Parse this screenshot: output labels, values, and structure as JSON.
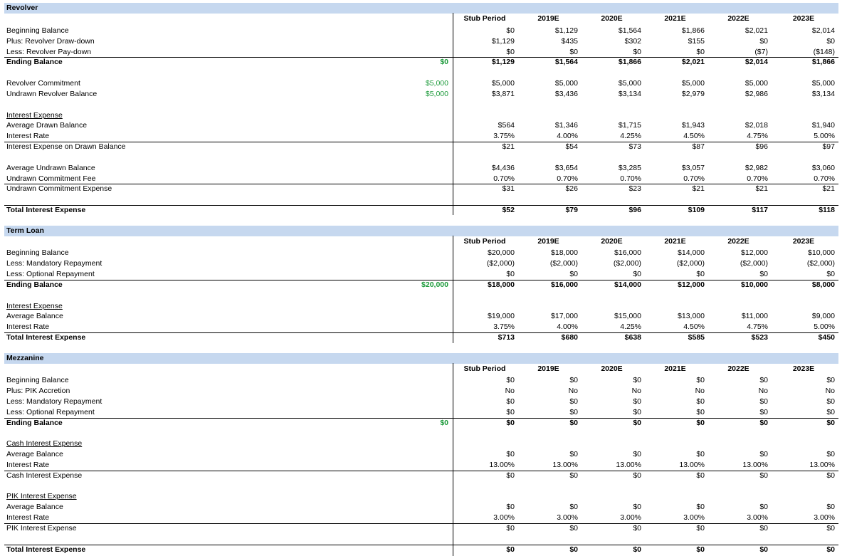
{
  "columns": [
    "Stub Period",
    "2019E",
    "2020E",
    "2021E",
    "2022E",
    "2023E"
  ],
  "revolver": {
    "title": "Revolver",
    "rows": [
      {
        "label": "Beginning Balance",
        "v": [
          "$0",
          "$1,129",
          "$1,564",
          "$1,866",
          "$2,021",
          "$2,014"
        ]
      },
      {
        "label": "Plus: Revolver Draw-down",
        "v": [
          "$1,129",
          "$435",
          "$302",
          "$155",
          "$0",
          "$0"
        ]
      },
      {
        "label": "Less: Revolver Pay-down",
        "v": [
          "$0",
          "$0",
          "$0",
          "$0",
          "($7)",
          "($148)"
        ]
      },
      {
        "label": "Ending Balance",
        "c0": "$0",
        "v": [
          "$1,129",
          "$1,564",
          "$1,866",
          "$2,021",
          "$2,014",
          "$1,866"
        ]
      },
      {
        "label": "Revolver Commitment",
        "c0": "$5,000",
        "v": [
          "$5,000",
          "$5,000",
          "$5,000",
          "$5,000",
          "$5,000",
          "$5,000"
        ]
      },
      {
        "label": "Undrawn Revolver Balance",
        "c0": "$5,000",
        "v": [
          "$3,871",
          "$3,436",
          "$3,134",
          "$2,979",
          "$2,986",
          "$3,134"
        ]
      },
      {
        "label": "Interest Expense",
        "v": [
          "",
          "",
          "",
          "",
          "",
          ""
        ]
      },
      {
        "label": "Average Drawn Balance",
        "v": [
          "$564",
          "$1,346",
          "$1,715",
          "$1,943",
          "$2,018",
          "$1,940"
        ]
      },
      {
        "label": "Interest Rate",
        "v": [
          "3.75%",
          "4.00%",
          "4.25%",
          "4.50%",
          "4.75%",
          "5.00%"
        ]
      },
      {
        "label": "Interest Expense on Drawn Balance",
        "v": [
          "$21",
          "$54",
          "$73",
          "$87",
          "$96",
          "$97"
        ]
      },
      {
        "label": "Average Undrawn Balance",
        "v": [
          "$4,436",
          "$3,654",
          "$3,285",
          "$3,057",
          "$2,982",
          "$3,060"
        ]
      },
      {
        "label": "Undrawn Commitment Fee",
        "v": [
          "0.70%",
          "0.70%",
          "0.70%",
          "0.70%",
          "0.70%",
          "0.70%"
        ]
      },
      {
        "label": "Undrawn Commitment Expense",
        "v": [
          "$31",
          "$26",
          "$23",
          "$21",
          "$21",
          "$21"
        ]
      },
      {
        "label": "Total Interest Expense",
        "v": [
          "$52",
          "$79",
          "$96",
          "$109",
          "$117",
          "$118"
        ]
      }
    ]
  },
  "term_loan": {
    "title": "Term Loan",
    "rows": [
      {
        "label": "Beginning Balance",
        "v": [
          "$20,000",
          "$18,000",
          "$16,000",
          "$14,000",
          "$12,000",
          "$10,000"
        ]
      },
      {
        "label": "Less: Mandatory Repayment",
        "v": [
          "($2,000)",
          "($2,000)",
          "($2,000)",
          "($2,000)",
          "($2,000)",
          "($2,000)"
        ]
      },
      {
        "label": "Less: Optional Repayment",
        "v": [
          "$0",
          "$0",
          "$0",
          "$0",
          "$0",
          "$0"
        ]
      },
      {
        "label": "Ending Balance",
        "c0": "$20,000",
        "v": [
          "$18,000",
          "$16,000",
          "$14,000",
          "$12,000",
          "$10,000",
          "$8,000"
        ]
      },
      {
        "label": "Interest Expense",
        "v": [
          "",
          "",
          "",
          "",
          "",
          ""
        ]
      },
      {
        "label": "Average Balance",
        "v": [
          "$19,000",
          "$17,000",
          "$15,000",
          "$13,000",
          "$11,000",
          "$9,000"
        ]
      },
      {
        "label": "Interest Rate",
        "v": [
          "3.75%",
          "4.00%",
          "4.25%",
          "4.50%",
          "4.75%",
          "5.00%"
        ]
      },
      {
        "label": "Total Interest Expense",
        "v": [
          "$713",
          "$680",
          "$638",
          "$585",
          "$523",
          "$450"
        ]
      }
    ]
  },
  "mezzanine": {
    "title": "Mezzanine",
    "rows": [
      {
        "label": "Beginning Balance",
        "v": [
          "$0",
          "$0",
          "$0",
          "$0",
          "$0",
          "$0"
        ]
      },
      {
        "label": "Plus: PIK Accretion",
        "v": [
          "No",
          "No",
          "No",
          "No",
          "No",
          "No"
        ]
      },
      {
        "label": "Less: Mandatory Repayment",
        "v": [
          "$0",
          "$0",
          "$0",
          "$0",
          "$0",
          "$0"
        ]
      },
      {
        "label": "Less: Optional Repayment",
        "v": [
          "$0",
          "$0",
          "$0",
          "$0",
          "$0",
          "$0"
        ]
      },
      {
        "label": "Ending Balance",
        "c0": "$0",
        "v": [
          "$0",
          "$0",
          "$0",
          "$0",
          "$0",
          "$0"
        ]
      },
      {
        "label": "Cash Interest Expense",
        "v": [
          "",
          "",
          "",
          "",
          "",
          ""
        ]
      },
      {
        "label": "Average Balance",
        "v": [
          "$0",
          "$0",
          "$0",
          "$0",
          "$0",
          "$0"
        ]
      },
      {
        "label": "Interest Rate",
        "v": [
          "13.00%",
          "13.00%",
          "13.00%",
          "13.00%",
          "13.00%",
          "13.00%"
        ]
      },
      {
        "label": "Cash Interest Expense",
        "v": [
          "$0",
          "$0",
          "$0",
          "$0",
          "$0",
          "$0"
        ]
      },
      {
        "label": "PIK Interest Expense",
        "v": [
          "",
          "",
          "",
          "",
          "",
          ""
        ]
      },
      {
        "label": "Average Balance",
        "v": [
          "$0",
          "$0",
          "$0",
          "$0",
          "$0",
          "$0"
        ]
      },
      {
        "label": "Interest Rate",
        "v": [
          "3.00%",
          "3.00%",
          "3.00%",
          "3.00%",
          "3.00%",
          "3.00%"
        ]
      },
      {
        "label": "PIK Interest Expense",
        "v": [
          "$0",
          "$0",
          "$0",
          "$0",
          "$0",
          "$0"
        ]
      },
      {
        "label": "Total Interest Expense",
        "v": [
          "$0",
          "$0",
          "$0",
          "$0",
          "$0",
          "$0"
        ]
      }
    ]
  }
}
